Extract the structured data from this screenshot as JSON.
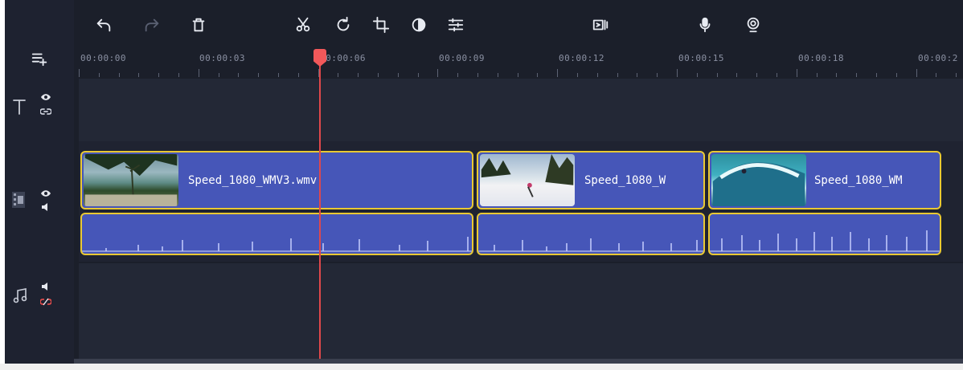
{
  "toolbar": {
    "icons": [
      "undo-icon",
      "redo-icon",
      "delete-icon",
      "cut-icon",
      "rotate-icon",
      "crop-icon",
      "color-adjust-icon",
      "properties-icon",
      "transitions-icon",
      "record-voice-icon",
      "webcam-icon"
    ]
  },
  "ruler": {
    "timecodes": [
      "00:00:00",
      "00:00:03",
      "00:00:06",
      "00:00:09",
      "00:00:12",
      "00:00:15",
      "00:00:18",
      "00:00:2"
    ]
  },
  "tracks": {
    "text": {
      "icon": "text-track-icon",
      "eye": "eye-icon",
      "link": "link-icon"
    },
    "video": {
      "icon": "video-track-icon",
      "eye": "eye-icon",
      "sound": "speaker-icon"
    },
    "audio": {
      "icon": "music-track-icon",
      "sound": "speaker-icon",
      "link": "unlink-icon"
    }
  },
  "clips": [
    {
      "title": "Speed_1080_WMV3.wmv"
    },
    {
      "title": "Speed_1080_W"
    },
    {
      "title": "Speed_1080_WM"
    }
  ],
  "colors": {
    "accent_border": "#e9c933",
    "clip_fill": "#4656b8",
    "playhead": "#e0484b",
    "background": "#1b1f2a"
  }
}
